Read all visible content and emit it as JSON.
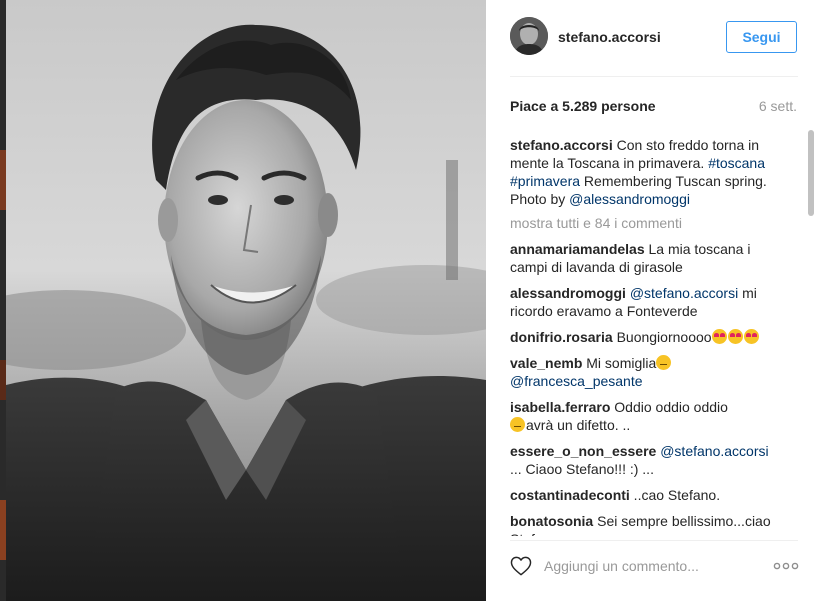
{
  "post": {
    "username": "stefano.accorsi",
    "follow_label": "Segui",
    "likes_text": "Piace a 5.289 persone",
    "age_text": "6 sett.",
    "caption": {
      "user": "stefano.accorsi",
      "text1": " Con sto freddo torna in mente la Toscana in primavera. ",
      "tag1": "#toscana",
      "tag2": "#primavera",
      "text2": " Remembering Tuscan spring. Photo by ",
      "mention": "@alessandromoggi"
    },
    "show_all_label": "mostra tutti e 84 i commenti"
  },
  "comments": [
    {
      "user": "annamariamandelas",
      "text": " La mia toscana i campi di lavanda di girasole"
    },
    {
      "user": "alessandromoggi",
      "mention": "@stefano.accorsi",
      "text": " mi ricordo eravamo a Fonteverde"
    },
    {
      "user": "donifrio.rosaria",
      "text": " Buongiornoooo"
    },
    {
      "user": "vale_nemb",
      "text": " Mi somiglia",
      "mention": "@francesca_pesante"
    },
    {
      "user": "isabella.ferraro",
      "text": " Oddio oddio oddio",
      "text2": "avrà un difetto. .."
    },
    {
      "user": "essere_o_non_essere",
      "mention": "@stefano.accorsi",
      "text": "... Ciaoo Stefano!!! :) ..."
    },
    {
      "user": "costantinadeconti",
      "text": " ..cao Stefano."
    },
    {
      "user": "bonatosonia",
      "text": " Sei sempre bellissimo...ciao Stefano"
    }
  ],
  "footer": {
    "comment_placeholder": "Aggiungi un commento...",
    "like_icon": "heart-outline-icon",
    "options_icon": "more-options-icon"
  },
  "colors": {
    "follow_blue": "#3897f0",
    "link_blue": "#003569",
    "muted_gray": "#999999",
    "divider": "#efefef"
  }
}
